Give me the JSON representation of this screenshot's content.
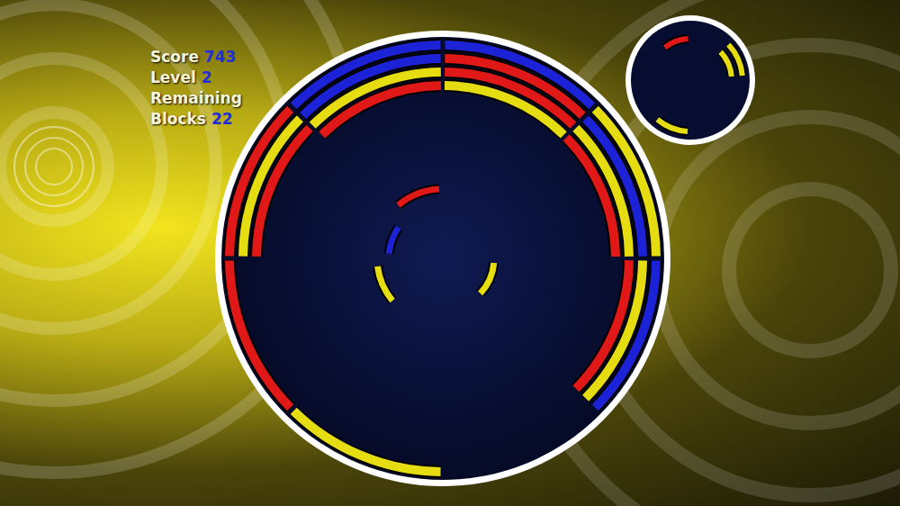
{
  "hud": [
    {
      "label": "Score",
      "value": "743"
    },
    {
      "label": "Level",
      "value": "2"
    },
    {
      "label": "Remaining Blocks",
      "value": "22"
    }
  ],
  "board": {
    "sectors": [
      {
        "rings": [
          {
            "color": "#1c22d6"
          },
          {
            "color": "#e01818"
          },
          {
            "color": "#e01818"
          },
          {
            "color": "#e6dc12"
          }
        ]
      },
      {
        "rings": [
          {
            "color": "#e6dc12"
          },
          {
            "color": "#1c22d6"
          },
          {
            "color": "#e6dc12"
          },
          {
            "color": "#e01818"
          }
        ]
      },
      {
        "rings": [
          {
            "color": "#1c22d6"
          },
          {
            "color": "#e6dc12"
          },
          {
            "color": "#e01818"
          }
        ]
      },
      {
        "rings": []
      },
      {
        "rings": [
          {
            "color": "#e6dc12"
          }
        ]
      },
      {
        "rings": [
          {
            "color": "#e01818"
          }
        ]
      },
      {
        "rings": [
          {
            "color": "#e01818"
          },
          {
            "color": "#e6dc12"
          },
          {
            "color": "#e01818"
          }
        ]
      },
      {
        "rings": [
          {
            "color": "#1c22d6"
          },
          {
            "color": "#1c22d6"
          },
          {
            "color": "#e6dc12"
          },
          {
            "color": "#e01818"
          }
        ]
      }
    ]
  },
  "falling_piece": [
    {
      "color": "#e01818",
      "radius": 77,
      "start": -40,
      "end": -3
    },
    {
      "color": "#1c22d6",
      "radius": 60,
      "start": -85,
      "end": -55
    },
    {
      "color": "#e6dc12",
      "radius": 73,
      "start": -130,
      "end": -97
    },
    {
      "color": "#e6dc12",
      "radius": 57,
      "start": 95,
      "end": 133
    }
  ],
  "next_piece": [
    {
      "color": "#e01818",
      "radius": 46,
      "start": -38,
      "end": -3
    },
    {
      "color": "#e6dc12",
      "radius": 46,
      "start": 47,
      "end": 85
    },
    {
      "color": "#e6dc12",
      "radius": 58,
      "start": 47,
      "end": 85
    },
    {
      "color": "#e6dc12",
      "radius": 57,
      "start": 183,
      "end": 220
    }
  ]
}
